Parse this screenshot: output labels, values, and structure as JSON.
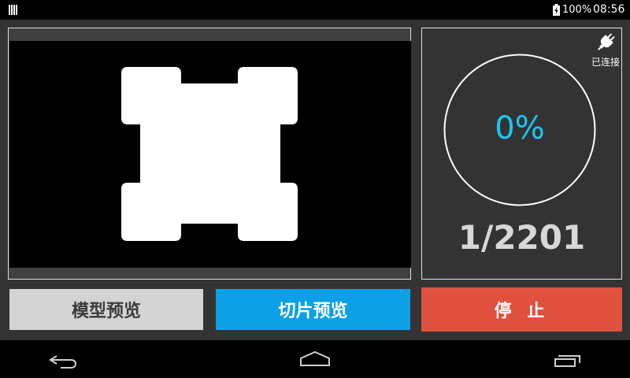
{
  "status_bar": {
    "battery_percent": "100%",
    "time": "08:56"
  },
  "connection": {
    "label": "已连接",
    "icon": "plug-icon"
  },
  "progress": {
    "percent_text": "0%",
    "fraction": 0,
    "layer_text": "1/2201",
    "accent_color": "#19c8f0"
  },
  "buttons": {
    "model_preview": "模型预览",
    "slice_preview": "切片预览",
    "stop": "停 止"
  },
  "colors": {
    "model_button": "#d4d4d4",
    "slice_button": "#0ea0e6",
    "stop_button": "#e0503f"
  },
  "nav": {
    "back_icon": "back-icon",
    "home_icon": "home-icon",
    "recents_icon": "recents-icon"
  }
}
